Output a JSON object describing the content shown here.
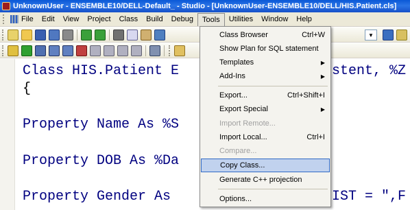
{
  "window": {
    "title": "UnknownUser - ENSEMBLE10/DELL-Default_ - Studio - [UnknownUser-ENSEMBLE10/DELL/HIS.Patient.cls]"
  },
  "menubar": {
    "items": [
      "File",
      "Edit",
      "View",
      "Project",
      "Class",
      "Build",
      "Debug",
      "Tools",
      "Utilities",
      "Window",
      "Help"
    ],
    "open_item": "Tools"
  },
  "editor": {
    "lines": [
      "Class HIS.Patient E",
      "{",
      "Property Name As %S",
      "Property DOB As %Da",
      "Property Gender As "
    ],
    "line1_tail": "stent, %Z",
    "line5_tail": "IST = \",F"
  },
  "tools_menu": {
    "items": [
      {
        "label": "Class Browser",
        "shortcut": "Ctrl+W",
        "submenu": false,
        "disabled": false
      },
      {
        "label": "Show Plan for SQL statement",
        "shortcut": "",
        "submenu": false,
        "disabled": false
      },
      {
        "label": "Templates",
        "shortcut": "",
        "submenu": true,
        "disabled": false
      },
      {
        "label": "Add-Ins",
        "shortcut": "",
        "submenu": true,
        "disabled": false
      },
      {
        "label": "Export...",
        "shortcut": "Ctrl+Shift+I",
        "submenu": false,
        "disabled": false
      },
      {
        "label": "Export Special",
        "shortcut": "",
        "submenu": true,
        "disabled": false
      },
      {
        "label": "Import Remote...",
        "shortcut": "",
        "submenu": false,
        "disabled": true
      },
      {
        "label": "Import Local...",
        "shortcut": "Ctrl+I",
        "submenu": false,
        "disabled": false
      },
      {
        "label": "Compare...",
        "shortcut": "",
        "submenu": false,
        "disabled": true
      },
      {
        "label": "Copy Class...",
        "shortcut": "",
        "submenu": false,
        "disabled": false,
        "highlighted": true
      },
      {
        "label": "Generate C++ projection",
        "shortcut": "",
        "submenu": false,
        "disabled": false
      },
      {
        "label": "Options...",
        "shortcut": "",
        "submenu": false,
        "disabled": false
      }
    ]
  },
  "colors": {
    "titlebar": "#0a58d6",
    "code_keyword": "#000080",
    "menu_highlight": "#c1d2ee"
  }
}
